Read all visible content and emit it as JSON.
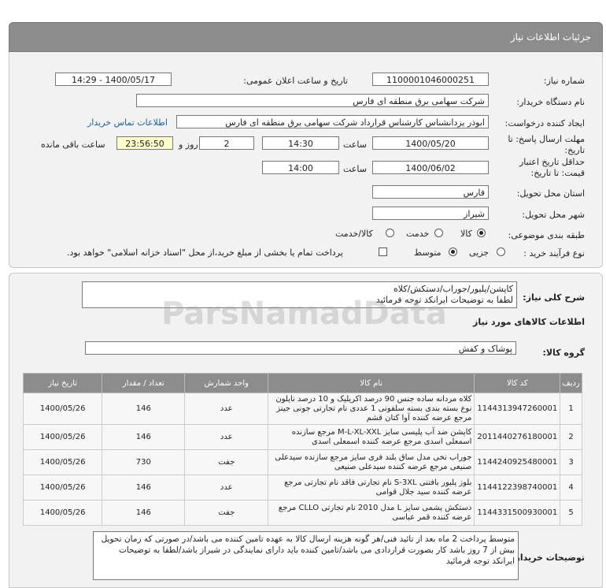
{
  "header": {
    "title": "جزئیات اطلاعات نیاز"
  },
  "form": {
    "need_number_label": "شماره نیاز:",
    "need_number": "1100001046000251",
    "announce_label": "تاریخ و ساعت اعلان عمومی:",
    "announce_value": "1400/05/17 - 14:29",
    "buyer_label": "نام دستگاه خریدار:",
    "buyer_value": "شرکت سهامی برق منطقه ای فارس",
    "creator_label": "ایجاد کننده درخواست:",
    "creator_value": "ابوذر  یزدانشناس کارشناس قرارداد شرکت سهامی برق منطقه ای فارس",
    "contact_link": "اطلاعات تماس خریدار",
    "deadline_label_1": "مهلت ارسال پاسخ: تا",
    "deadline_label_2": "تاریخ:",
    "deadline_date": "1400/05/20",
    "time_label": "ساعت",
    "deadline_time": "14:30",
    "days_value": "2",
    "days_label": "روز و",
    "remaining_time": "23:56:50",
    "remaining_label": "ساعت باقی مانده",
    "validity_label_1": "حداقل تاریخ اعتبار",
    "validity_label_2": "قیمت: تا تاریخ:",
    "validity_date": "1400/06/02",
    "validity_time_label": "ساعت",
    "validity_time": "14:00",
    "province_label": "استان محل تحویل:",
    "province_value": "فارس",
    "city_label": "شهر محل تحویل:",
    "city_value": "شیراز",
    "category_label": "طبقه بندی موضوعی:",
    "category_options": [
      "کالا",
      "خدمت",
      "کالا/خدمت"
    ],
    "purchase_label": "نوع فرآیند خرید :",
    "purchase_options": [
      "جزیی",
      "متوسط"
    ],
    "payment_text": "پرداخت تمام یا بخشی از مبلغ خرید،از محل \"اسناد خزانه اسلامی\" خواهد بود."
  },
  "details": {
    "summary_label": "شرح کلی نیاز:",
    "summary_line1": "کاپشن/پلیور/جوراب/دستکش/کلاه",
    "summary_line2": "لطفا به توضیحات ایرانکد توجه فرمائید",
    "goods_info_title": "اطلاعات کالاهای مورد نیاز",
    "goods_group_label": "گروه کالا:",
    "goods_group_value": "پوشاک و کفش"
  },
  "table": {
    "headers": [
      "ردیف",
      "کد کالا",
      "نام کالا",
      "واحد شمارش",
      "تعداد / مقدار",
      "تاریخ نیاز"
    ],
    "rows": [
      [
        "1",
        "1144313947260001",
        "کلاه مردانه ساده جنس 90 درصد اکریلیک و 10 درصد نایلون نوع بسته بندی بسته سلفونی 1 عددی نام تجارتی جونی جینز مرجع عرضه کننده آوا کتان قشم",
        "عدد",
        "146",
        "1400/05/26"
      ],
      [
        "2",
        "2011440276180001",
        "کاپشن ضد آب پلیسی سایز M-L-XL-XXL مرجع سازنده اسمعلی اسدی مرجع عرضه کننده اسمعلی اسدی",
        "عدد",
        "146",
        "1400/05/26"
      ],
      [
        "3",
        "1144240925480001",
        "جوراب نخی مدل ساق بلند فری سایز مرجع سازنده سیدعلی صنیعی مرجع عرضه کننده سیدعلی صنیعی",
        "جفت",
        "730",
        "1400/05/26"
      ],
      [
        "4",
        "1144122398740001",
        "بلوز پلیور بافتنی S-3XL نام تجارتی فاقد نام تجارتی مرجع عرضه کننده سید جلال قوامی",
        "عدد",
        "146",
        "1400/05/26"
      ],
      [
        "5",
        "1144331500930001",
        "دستکش پشمی سایز L مدل 2010 نام تجارتی CLLO مرجع عرضه کننده قمر عباسی",
        "جفت",
        "146",
        "1400/05/26"
      ]
    ]
  },
  "buyer_notes": {
    "label": "توضیحات خریدار:",
    "text": "متوسط پرداخت 2 ماه بعد از تائید فنی/هر گونه هزینه ارسال کالا به عهده تامین کننده می باشد/در صورتی که زمان تحویل بیش از 7 روز باشد کار بصورت قراردادی می باشد/تامین کننده باید دارای نمایندگی در شیراز باشد/لطفا به توضیحات ایرانکد توجه فرمائید"
  }
}
